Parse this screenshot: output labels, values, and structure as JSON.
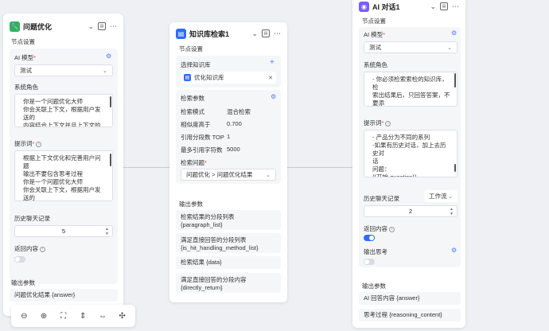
{
  "colors": {
    "accent": "#4f7cf7",
    "toggle_on": "#2f6bff",
    "toggle_off": "#d9dbe0",
    "node1_icon": "#2fb35a",
    "node2_icon": "#2f6bff",
    "node3_icon": "#7b5cff"
  },
  "node_optimize": {
    "title": "问题优化",
    "icon": "wrench-icon",
    "section_settings": "节点设置",
    "model_label": "AI 模型",
    "model_value": "测试",
    "role_label": "系统角色",
    "role_text": "你是一个问题优化大师\n你会关联上下文，根据用户发送的\n内容结合上下文并且上下文的内容会",
    "prompt_label": "提示词",
    "prompt_text": "根据上下文优化和完善用户问题\n输出不要包含思考过程\n你是一个问题优化大师\n你会关联上下文，根据用户发送的\n内容结合上下文进行优化",
    "history_label": "历史聊天记录",
    "history_value": "5",
    "return_label": "返回内容",
    "return_on": false,
    "section_output": "输出参数",
    "outputs": [
      "问题优化结果 {answer}"
    ]
  },
  "node_kb": {
    "title": "知识库检索1",
    "icon": "knowledge-base-icon",
    "section_settings": "节点设置",
    "select_kb_label": "选择知识库",
    "kb_chip": "优化知识库",
    "retrieval_label": "检索参数",
    "params": [
      {
        "label": "检索模式",
        "value": "混合检索"
      },
      {
        "label": "相似度高于",
        "value": "0.700"
      },
      {
        "label": "引用分段数 TOP",
        "value": "1"
      },
      {
        "label": "最多引用字符数",
        "value": "5000"
      }
    ],
    "question_label": "检索问题",
    "question_value": "问题优化 > 问题优化结果",
    "section_output": "输出参数",
    "outputs": [
      "检索结果的分段列表\n{paragraph_list}",
      "满足直接回答的分段列表\n{is_hit_handling_method_list}",
      "检索结果 {data}",
      "满足直接回答的分段内容\n{directly_return}"
    ]
  },
  "node_ai": {
    "title": "AI 对话1",
    "icon": "ai-chat-icon",
    "section_settings": "节点设置",
    "model_label": "AI 模型",
    "model_value": "测试",
    "role_label": "系统角色",
    "role_text": "- 你必须检索索检的知识库，检\n索出结果后，只回答答案，不要添\n加多余的语气词，除非客户主动要\n求有多个十 需要进行多个结果",
    "prompt_label": "提示词",
    "prompt_text": "- 产品分为不同的系列\n-如果有历史对话，加上去历史对\n话\n问题：\n{{开始.question}}",
    "history_label": "历史聊天记录",
    "history_mode": "工作流",
    "history_value": "2",
    "return_label": "返回内容",
    "return_on": true,
    "think_label": "输出思考",
    "think_on": false,
    "section_output": "输出参数",
    "outputs": [
      "AI 回答内容 {answer}",
      "思考过程 {reasoning_content}"
    ]
  },
  "toolbar": [
    "zoom-out-icon",
    "zoom-in-icon",
    "fit-view-icon",
    "align-vertical-icon",
    "align-horizontal-icon",
    "auto-layout-icon"
  ]
}
